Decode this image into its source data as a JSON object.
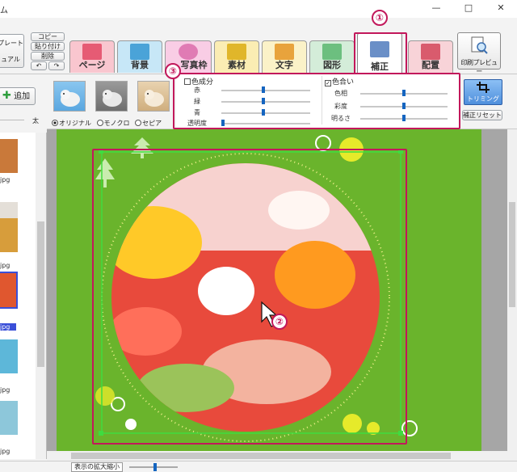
{
  "window": {
    "title": "ム",
    "minimize": "—",
    "maximize": "□",
    "close": "✕"
  },
  "toolbar": {
    "left_buttons": [
      "プレート",
      "ュアル"
    ],
    "edit_buttons": {
      "copy": "コピー",
      "paste": "貼り付け",
      "delete": "削除",
      "undo": "↶",
      "redo": "↷"
    },
    "tabs": [
      {
        "id": "page",
        "label": "ページ",
        "color": "#f9c6cf",
        "icon_color": "#e65b74"
      },
      {
        "id": "background",
        "label": "背景",
        "color": "#c7e7f7",
        "icon_color": "#4aa3d8"
      },
      {
        "id": "frame",
        "label": "写真枠",
        "color": "#f9cde5",
        "icon_color": "#e07bb4"
      },
      {
        "id": "material",
        "label": "素材",
        "color": "#fbedb3",
        "icon_color": "#e0b62a"
      },
      {
        "id": "text",
        "label": "文字",
        "color": "#fbf2c8",
        "icon_color": "#e8a33c"
      },
      {
        "id": "shape",
        "label": "図形",
        "color": "#d4edd9",
        "icon_color": "#6cbf7f"
      },
      {
        "id": "correction",
        "label": "補正",
        "color": "#ffffff",
        "icon_color": "#6a8fc7"
      },
      {
        "id": "layout",
        "label": "配置",
        "color": "#f8d3d8",
        "icon_color": "#d95b6d"
      }
    ],
    "active_tab": "補正",
    "print_preview": "印刷プレビュー"
  },
  "callouts": {
    "one": "①",
    "two": "②",
    "three": "③"
  },
  "left_panel": {
    "add_button": "追加",
    "add_icon": "plus-icon",
    "size_label": "太",
    "thumbnails": [
      {
        "caption": "jpg",
        "color": "#c9793a"
      },
      {
        "caption": "jpg",
        "color": "#e4dfd8"
      },
      {
        "caption": "jpg",
        "color": "#d79d3b"
      },
      {
        "caption": "jpg",
        "color": "#e0572f"
      },
      {
        "caption": "jpg",
        "color": "#5db7d9"
      },
      {
        "caption": "jpg",
        "color": "#8dc7da"
      },
      {
        "caption": "jpg",
        "color": "#bcd6e0"
      }
    ]
  },
  "properties": {
    "filter_options": [
      "オリジナル",
      "モノクロ",
      "セピア"
    ],
    "selected_filter": "オリジナル",
    "color_component": {
      "label": "色成分",
      "sliders": [
        {
          "label": "赤",
          "value": 0.5
        },
        {
          "label": "緑",
          "value": 0.5
        },
        {
          "label": "青",
          "value": 0.5
        },
        {
          "label": "透明度",
          "value": 0.0
        }
      ]
    },
    "hue_group": {
      "label": "色合い",
      "checked": true,
      "sliders": [
        {
          "label": "色相",
          "value": 0.5
        },
        {
          "label": "彩度",
          "value": 0.5
        },
        {
          "label": "明るさ",
          "value": 0.5
        }
      ]
    },
    "trimming_button": "トリミング",
    "reset_button": "補正リセット"
  },
  "statusbar": {
    "zoom_label": "表示の拡大縮小",
    "zoom_value": 0.5
  }
}
